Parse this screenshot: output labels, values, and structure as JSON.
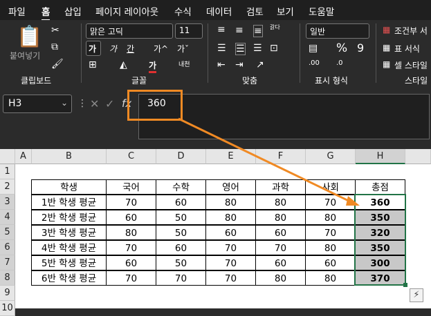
{
  "menu": {
    "items": [
      "파일",
      "홈",
      "삽입",
      "페이지 레이아웃",
      "수식",
      "데이터",
      "검토",
      "보기",
      "도움말"
    ],
    "active": "홈"
  },
  "ribbon": {
    "clipboard": {
      "paste_label": "붙여넣기",
      "group": "클립보드"
    },
    "font": {
      "name": "맑은 고딕",
      "size": "11",
      "bold": "가",
      "italic": "가",
      "underline": "간",
      "grow": "가^",
      "shrink": "가ˇ",
      "font_color": "가",
      "phonetic": "내천",
      "group": "글꼴"
    },
    "alignment": {
      "wrap": "갉다",
      "group": "맞춤"
    },
    "number": {
      "format": "일반",
      "percent": "%",
      "comma": "9",
      "group": "표시 형식"
    },
    "styles": {
      "conditional": "조건부 서",
      "table": "표 서식",
      "cell": "셀 스타일",
      "group": "스타일"
    }
  },
  "formula_bar": {
    "name_box": "H3",
    "fx": "fx",
    "value": "360"
  },
  "columns": [
    "A",
    "B",
    "C",
    "D",
    "E",
    "F",
    "G",
    "H"
  ],
  "rows": [
    "1",
    "2",
    "3",
    "4",
    "5",
    "6",
    "7",
    "8",
    "9",
    "10"
  ],
  "table": {
    "headers": [
      "학생",
      "국어",
      "수학",
      "영어",
      "과학",
      "사회",
      "총점"
    ],
    "rows": [
      {
        "label": "1반 학생 평균",
        "values": [
          "70",
          "60",
          "80",
          "80",
          "70"
        ],
        "total": "360"
      },
      {
        "label": "2반 학생 평균",
        "values": [
          "60",
          "50",
          "80",
          "80",
          "80"
        ],
        "total": "350"
      },
      {
        "label": "3반 학생 평균",
        "values": [
          "80",
          "50",
          "60",
          "60",
          "70"
        ],
        "total": "320"
      },
      {
        "label": "4반 학생 평균",
        "values": [
          "70",
          "60",
          "70",
          "70",
          "80"
        ],
        "total": "350"
      },
      {
        "label": "5반 학생 평균",
        "values": [
          "60",
          "50",
          "70",
          "60",
          "60"
        ],
        "total": "300"
      },
      {
        "label": "6반 학생 평균",
        "values": [
          "70",
          "70",
          "70",
          "80",
          "80"
        ],
        "total": "370"
      }
    ]
  },
  "colors": {
    "accent_orange": "#f08a24",
    "selection_green": "#217346",
    "highlight_gray": "#c8c8c8"
  }
}
